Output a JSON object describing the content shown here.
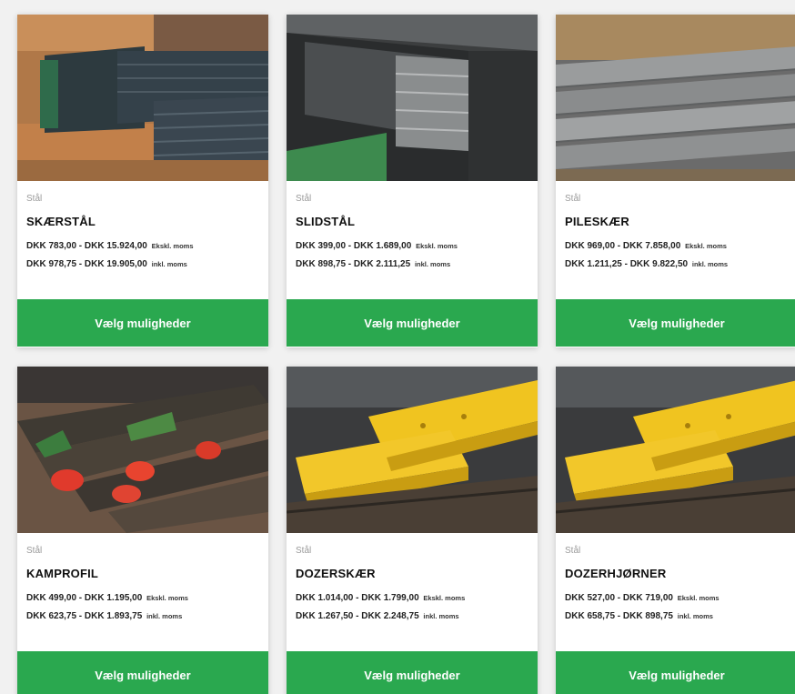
{
  "products": [
    {
      "image": "stacked-dark-steel-plates-photo",
      "category": "Stål",
      "title": "SKÆRSTÅL",
      "price_excl": "DKK 783,00 - DKK 15.924,00",
      "price_excl_suffix": "Ekskl. moms",
      "price_incl": "DKK 978,75 - DKK 19.905,00",
      "price_incl_suffix": "inkl. moms",
      "button": "Vælg muligheder"
    },
    {
      "image": "steel-bars-closeup-photo",
      "category": "Stål",
      "title": "SLIDSTÅL",
      "price_excl": "DKK 399,00 - DKK 1.689,00",
      "price_excl_suffix": "Ekskl. moms",
      "price_incl": "DKK 898,75 - DKK 2.111,25",
      "price_incl_suffix": "inkl. moms",
      "button": "Vælg muligheder"
    },
    {
      "image": "grey-blades-stack-photo",
      "category": "Stål",
      "title": "PILESKÆR",
      "price_excl": "DKK 969,00 - DKK 7.858,00",
      "price_excl_suffix": "Ekskl. moms",
      "price_incl": "DKK 1.211,25 - DKK 9.822,50",
      "price_incl_suffix": "inkl. moms",
      "button": "Vælg muligheder"
    },
    {
      "image": "red-tipped-profiles-photo",
      "category": "Stål",
      "title": "KAMPROFIL",
      "price_excl": "DKK 499,00 - DKK 1.195,00",
      "price_excl_suffix": "Ekskl. moms",
      "price_incl": "DKK 623,75 - DKK 1.893,75",
      "price_incl_suffix": "inkl. moms",
      "button": "Vælg muligheder"
    },
    {
      "image": "yellow-dozer-blades-photo",
      "category": "Stål",
      "title": "DOZERSKÆR",
      "price_excl": "DKK 1.014,00 - DKK 1.799,00",
      "price_excl_suffix": "Ekskl. moms",
      "price_incl": "DKK 1.267,50 - DKK 2.248,75",
      "price_incl_suffix": "inkl. moms",
      "button": "Vælg muligheder"
    },
    {
      "image": "yellow-dozer-corners-photo",
      "category": "Stål",
      "title": "DOZERHJØRNER",
      "price_excl": "DKK 527,00 - DKK 719,00",
      "price_excl_suffix": "Ekskl. moms",
      "price_incl": "DKK 658,75 - DKK 898,75",
      "price_incl_suffix": "inkl. moms",
      "button": "Vælg muligheder"
    }
  ],
  "colors": {
    "button_green": "#2aa84f",
    "page_bg": "#f1f1f1"
  }
}
